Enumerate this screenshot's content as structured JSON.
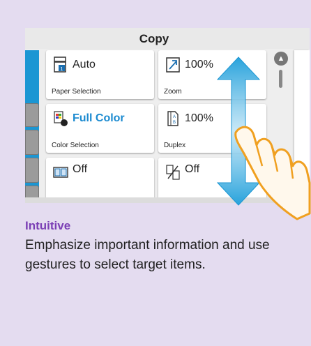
{
  "screen": {
    "title": "Copy",
    "tiles": [
      {
        "value": "Auto",
        "label": "Paper Selection",
        "icon": "paper-tray-icon"
      },
      {
        "value": "100%",
        "label": "Zoom",
        "icon": "zoom-arrow-icon"
      },
      {
        "value": "Full Color",
        "label": "Color Selection",
        "icon": "color-palette-icon",
        "accent": "#1b8ad0"
      },
      {
        "value": "100%",
        "label": "Duplex",
        "icon": "duplex-page-icon"
      },
      {
        "value": "Off",
        "label": "",
        "icon": "combine-pages-icon"
      },
      {
        "value": "Off",
        "label": "",
        "icon": "staple-pages-icon"
      }
    ],
    "scroll_up_icon": "chevron-up-icon",
    "gesture_icon": "swipe-hand-icon",
    "gesture_arrow_icon": "vertical-double-arrow-icon"
  },
  "caption": {
    "heading": "Intuitive",
    "text": "Emphasize important information and use gestures to select target items."
  },
  "colors": {
    "background": "#e4dcf0",
    "accent_blue": "#1b96d3",
    "heading_purple": "#7b3fb5",
    "hand_orange": "#f0a020"
  }
}
